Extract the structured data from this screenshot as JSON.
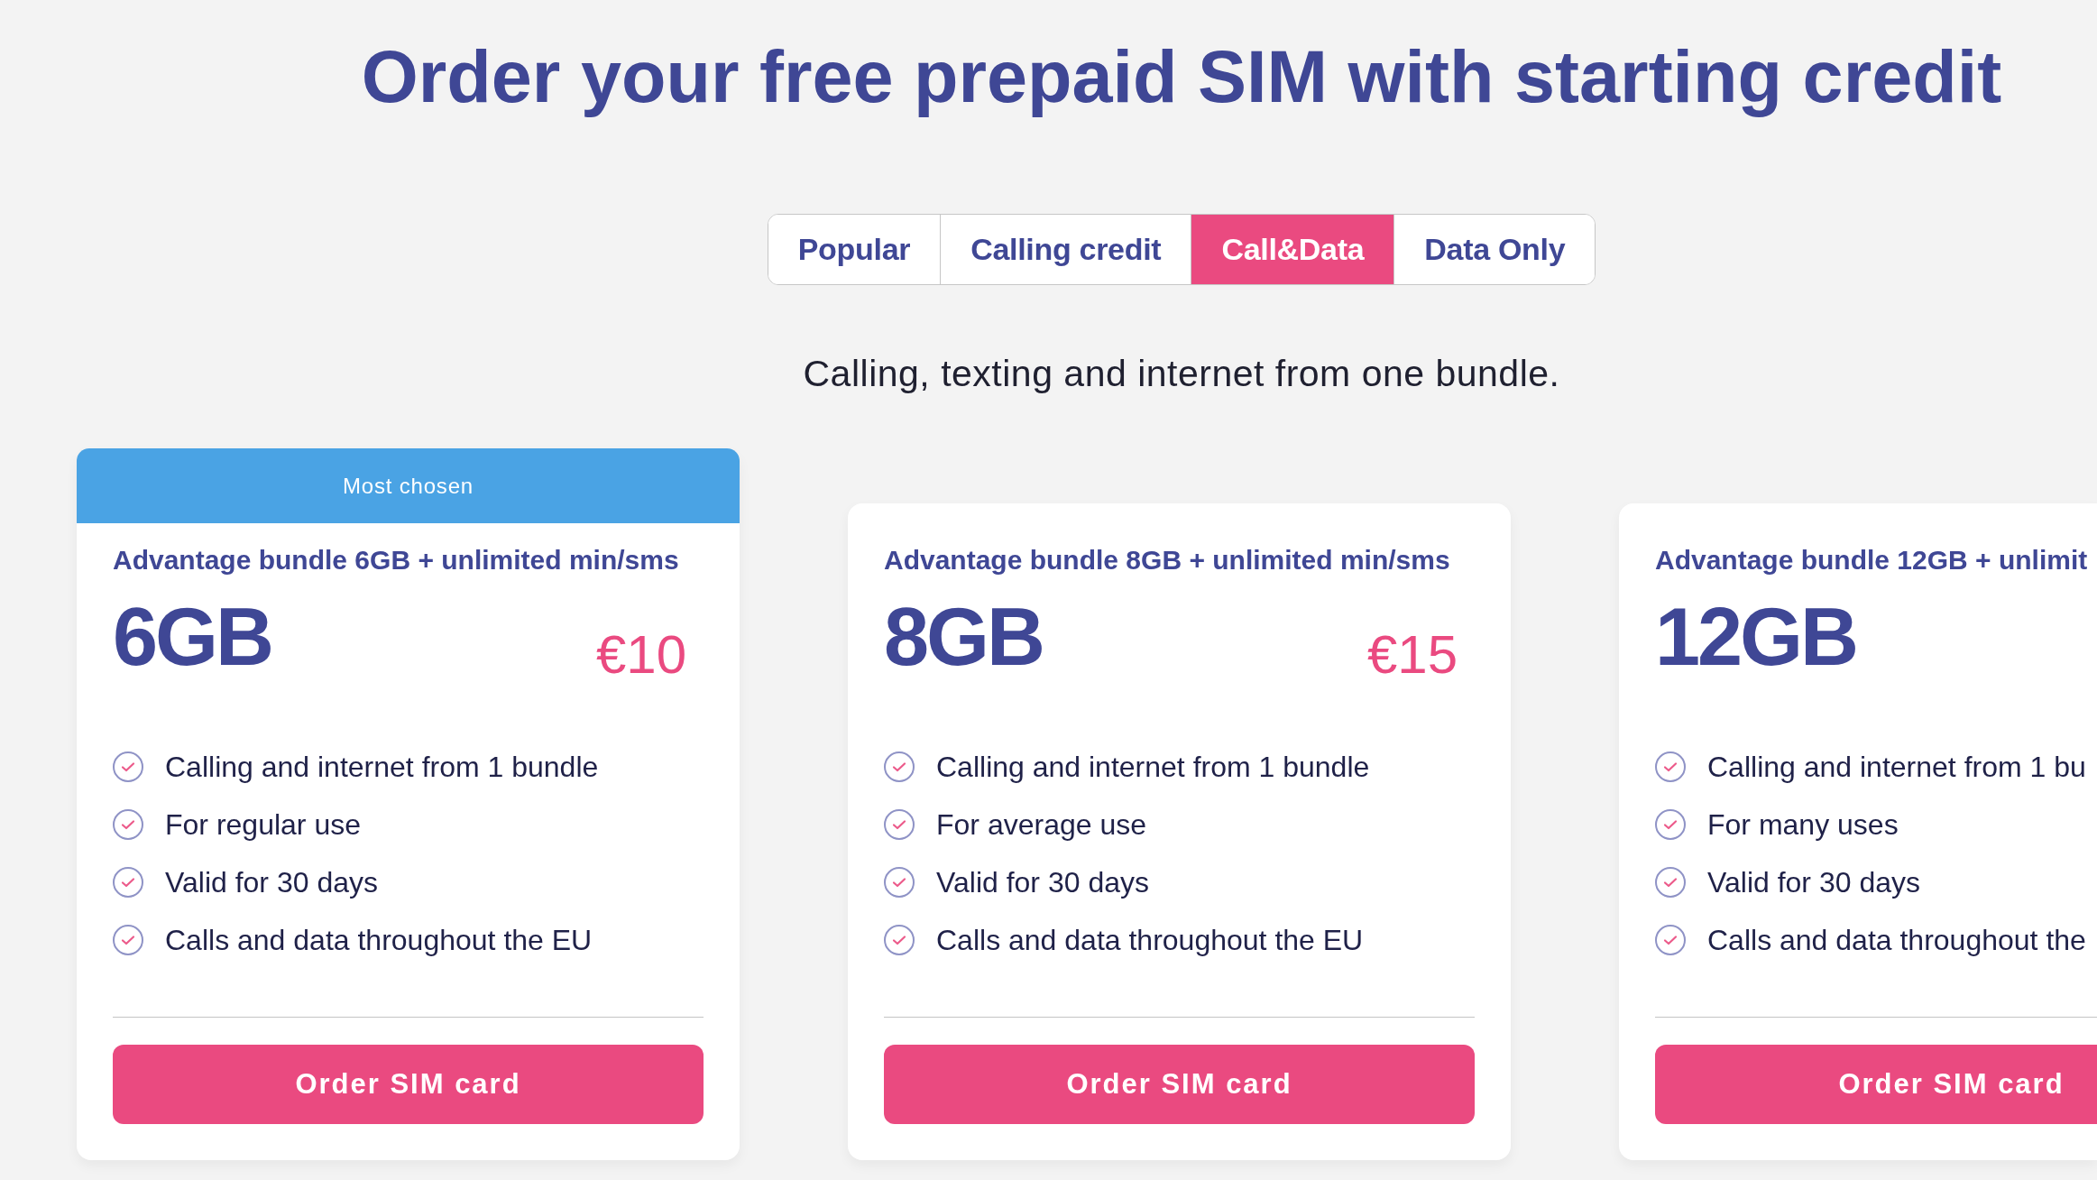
{
  "heading": "Order your free prepaid SIM with starting credit",
  "tabs": [
    {
      "label": "Popular",
      "selected": false
    },
    {
      "label": "Calling credit",
      "selected": false
    },
    {
      "label": "Call&Data",
      "selected": true
    },
    {
      "label": "Data Only",
      "selected": false
    }
  ],
  "subtitle": "Calling, texting and internet from one bundle.",
  "plans": [
    {
      "ribbon": "Most chosen",
      "title": "Advantage bundle 6GB + unlimited min/sms",
      "data": "6GB",
      "price": "€10",
      "features": [
        "Calling and internet from 1 bundle",
        "For regular use",
        "Valid for 30 days",
        "Calls and data throughout the EU"
      ],
      "button": "Order SIM card"
    },
    {
      "title": "Advantage bundle 8GB + unlimited min/sms",
      "data": "8GB",
      "price": "€15",
      "features": [
        "Calling and internet from 1 bundle",
        "For average use",
        "Valid for 30 days",
        "Calls and data throughout the EU"
      ],
      "button": "Order SIM card"
    },
    {
      "title": "Advantage bundle 12GB + unlimit",
      "data": "12GB",
      "features": [
        "Calling and internet from 1 bu",
        "For many uses",
        "Valid for 30 days",
        "Calls and data throughout the"
      ],
      "button": "Order SIM card"
    }
  ]
}
